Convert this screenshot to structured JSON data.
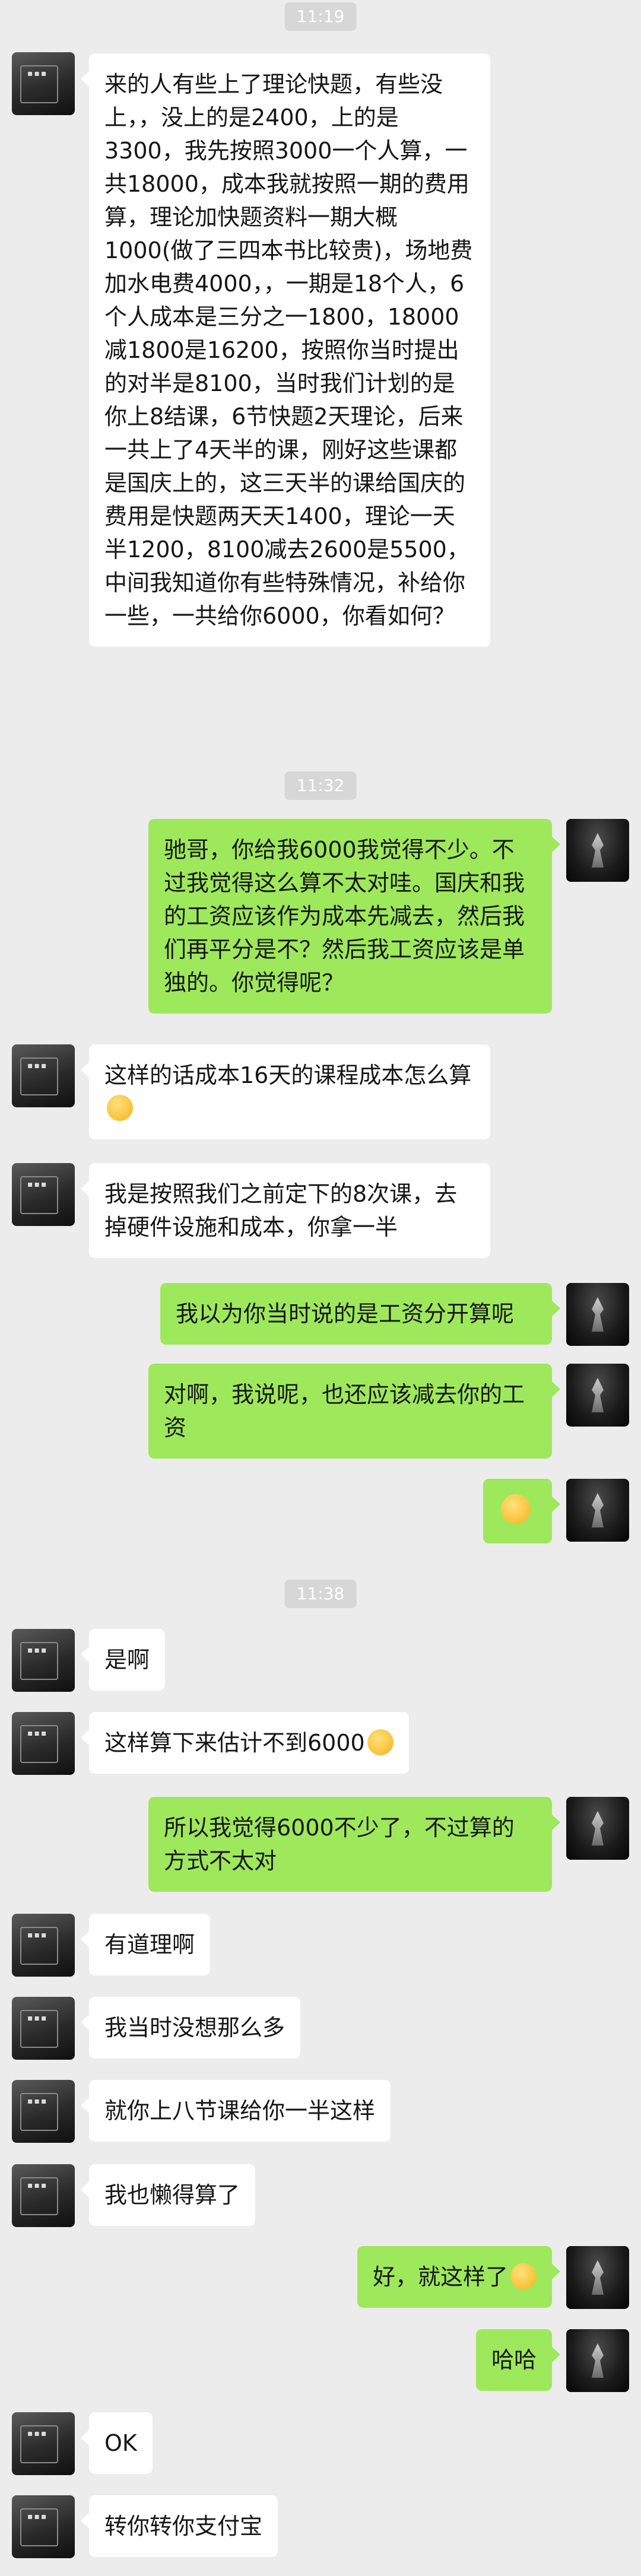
{
  "timestamps": [
    "11:19",
    "11:32",
    "11:38"
  ],
  "messages": [
    {
      "text": "来的人有些上了理论快题，有些没上，，没上的是2400，上的是3300，我先按照3000一个人算，一共18000，成本我就按照一期的费用算，理论加快题资料一期大概1000(做了三四本书比较贵)，场地费加水电费4000，，一期是18个人，6个人成本是三分之一1800，18000减1800是16200，按照你当时提出的对半是8100，当时我们计划的是你上8结课，6节快题2天理论，后来一共上了4天半的课，刚好这些课都是国庆上的，这三天半的课给国庆的费用是快题两天天1400，理论一天半1200，8100减去2600是5500，中间我知道你有些特殊情况，补给你一些，一共给你6000，你看如何？"
    },
    {
      "text": "驰哥，你给我6000我觉得不少。不过我觉得这么算不太对哇。国庆和我的工资应该作为成本先减去，然后我们再平分是不？然后我工资应该是单独的。你觉得呢？"
    },
    {
      "text": "这样的话成本16天的课程成本怎么算",
      "emoji": "sweat-laugh-emoji"
    },
    {
      "text": "我是按照我们之前定下的8次课，去掉硬件设施和成本，你拿一半"
    },
    {
      "text": "我以为你当时说的是工资分开算呢"
    },
    {
      "text": "对啊，我说呢，也还应该减去你的工资"
    },
    {
      "text": "",
      "emoji": "tongue-out-emoji"
    },
    {
      "text": "是啊"
    },
    {
      "text": "这样算下来估计不到6000",
      "emoji": "sweat-laugh-emoji"
    },
    {
      "text": "所以我觉得6000不少了，不过算的方式不太对"
    },
    {
      "text": "有道理啊"
    },
    {
      "text": "我当时没想那么多"
    },
    {
      "text": "就你上八节课给你一半这样"
    },
    {
      "text": "我也懒得算了"
    },
    {
      "text": "好，就这样了",
      "emoji": "smirk-emoji"
    },
    {
      "text": "哈哈"
    },
    {
      "text": "OK"
    },
    {
      "text": "转你转你支付宝"
    }
  ]
}
